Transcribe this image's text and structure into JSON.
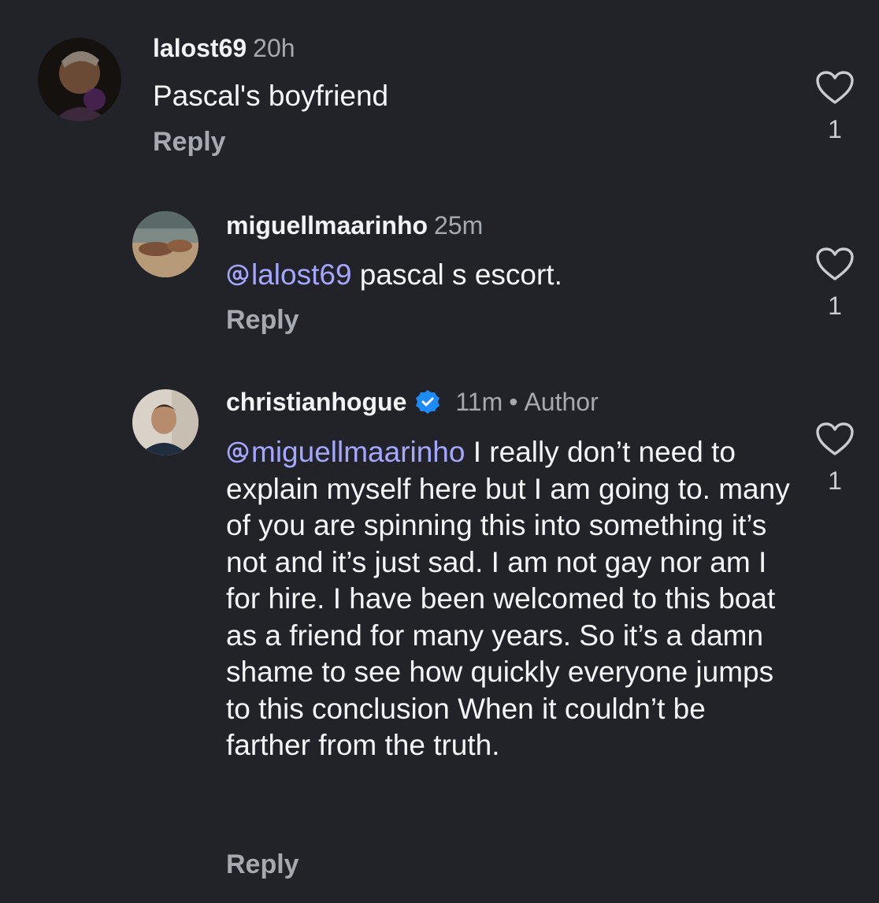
{
  "comments": [
    {
      "username": "lalost69",
      "time": "20h",
      "text": "Pascal's boyfriend",
      "reply_label": "Reply",
      "likes": "1",
      "avatar_icon": "profile-photo"
    },
    {
      "username": "miguellmaarinho",
      "time": "25m",
      "mention": "lalost69",
      "text": " pascal s escort.",
      "reply_label": "Reply",
      "likes": "1",
      "avatar_icon": "profile-photo"
    },
    {
      "username": "christianhogue",
      "verified": true,
      "time": "11m",
      "separator": "•",
      "author_tag": "Author",
      "mention": "miguellmaarinho",
      "text": " I really don’t need to explain myself here but I am going to. many of you are spinning this into something it’s not and it’s just sad. I am not gay nor am I for hire. I have been welcomed to this boat as a friend for many years. So it’s a damn shame to see how quickly everyone jumps to this conclusion When it couldn’t be farther from the truth.",
      "reply_label": "Reply",
      "likes": "1",
      "avatar_icon": "profile-photo"
    }
  ],
  "icons": {
    "like": "heart-outline-icon",
    "verified": "verified-badge-icon",
    "mention": "threads-at-icon"
  },
  "colors": {
    "background": "#222329",
    "text": "#f2f3f5",
    "muted": "#a7a9b0",
    "mention": "#a5a6ff",
    "verified": "#1d8cf8"
  }
}
